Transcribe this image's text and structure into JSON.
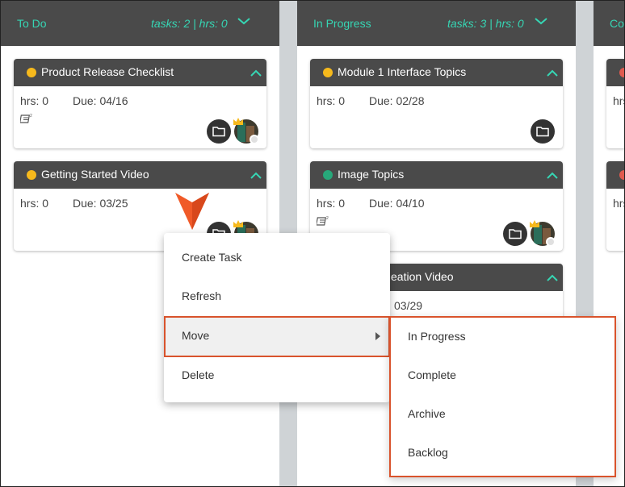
{
  "colors": {
    "header_bg": "#4a4a4a",
    "accent_teal": "#36d6b4",
    "status_yellow": "#f6b91c",
    "status_green": "#27a87a",
    "status_red": "#e05a4f",
    "highlight_outline": "#d9532c",
    "pointer": "#f05a28"
  },
  "columns": [
    {
      "title": "To Do",
      "stats": "tasks: 2 | hrs: 0",
      "cards": [
        {
          "title": "Product Release Checklist",
          "status": "yellow",
          "hrs": "hrs: 0",
          "due": "Due: 04/16",
          "has_notes": true
        },
        {
          "title": "Getting Started Video",
          "status": "yellow",
          "hrs": "hrs: 0",
          "due": "Due: 03/25",
          "has_notes": false
        }
      ]
    },
    {
      "title": "In Progress",
      "stats": "tasks: 3 | hrs: 0",
      "cards": [
        {
          "title": "Module 1 Interface Topics",
          "status": "yellow",
          "hrs": "hrs: 0",
          "due": "Due: 02/28",
          "has_notes": false
        },
        {
          "title": "Image Topics",
          "status": "green",
          "hrs": "hrs: 0",
          "due": "Due: 04/10",
          "has_notes": true
        },
        {
          "title": "eation Video",
          "status": "yellow",
          "due": "03/29"
        }
      ]
    },
    {
      "title": "Co",
      "cards": [
        {
          "status": "red",
          "hrs": "hrs"
        },
        {
          "status": "red",
          "hrs": "hrs"
        }
      ]
    }
  ],
  "context_menu": {
    "items": [
      "Create Task",
      "Refresh",
      "Move",
      "Delete"
    ],
    "active_item": "Move",
    "submenu": [
      "In Progress",
      "Complete",
      "Archive",
      "Backlog"
    ]
  }
}
